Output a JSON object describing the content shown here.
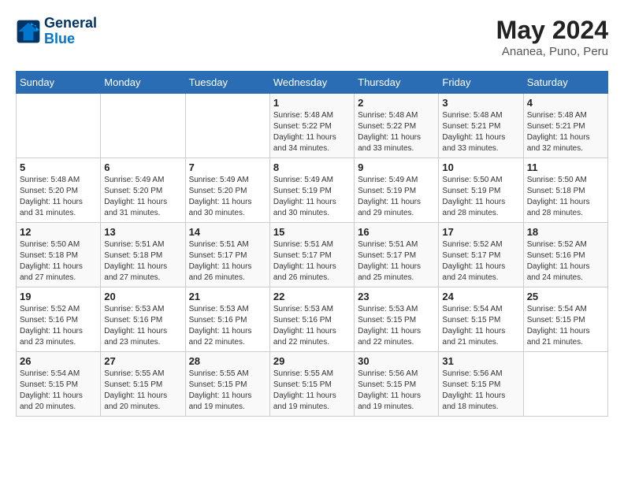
{
  "header": {
    "logo_line1": "General",
    "logo_line2": "Blue",
    "month_year": "May 2024",
    "location": "Ananea, Puno, Peru"
  },
  "weekdays": [
    "Sunday",
    "Monday",
    "Tuesday",
    "Wednesday",
    "Thursday",
    "Friday",
    "Saturday"
  ],
  "weeks": [
    [
      {
        "day": "",
        "info": ""
      },
      {
        "day": "",
        "info": ""
      },
      {
        "day": "",
        "info": ""
      },
      {
        "day": "1",
        "info": "Sunrise: 5:48 AM\nSunset: 5:22 PM\nDaylight: 11 hours\nand 34 minutes."
      },
      {
        "day": "2",
        "info": "Sunrise: 5:48 AM\nSunset: 5:22 PM\nDaylight: 11 hours\nand 33 minutes."
      },
      {
        "day": "3",
        "info": "Sunrise: 5:48 AM\nSunset: 5:21 PM\nDaylight: 11 hours\nand 33 minutes."
      },
      {
        "day": "4",
        "info": "Sunrise: 5:48 AM\nSunset: 5:21 PM\nDaylight: 11 hours\nand 32 minutes."
      }
    ],
    [
      {
        "day": "5",
        "info": "Sunrise: 5:48 AM\nSunset: 5:20 PM\nDaylight: 11 hours\nand 31 minutes."
      },
      {
        "day": "6",
        "info": "Sunrise: 5:49 AM\nSunset: 5:20 PM\nDaylight: 11 hours\nand 31 minutes."
      },
      {
        "day": "7",
        "info": "Sunrise: 5:49 AM\nSunset: 5:20 PM\nDaylight: 11 hours\nand 30 minutes."
      },
      {
        "day": "8",
        "info": "Sunrise: 5:49 AM\nSunset: 5:19 PM\nDaylight: 11 hours\nand 30 minutes."
      },
      {
        "day": "9",
        "info": "Sunrise: 5:49 AM\nSunset: 5:19 PM\nDaylight: 11 hours\nand 29 minutes."
      },
      {
        "day": "10",
        "info": "Sunrise: 5:50 AM\nSunset: 5:19 PM\nDaylight: 11 hours\nand 28 minutes."
      },
      {
        "day": "11",
        "info": "Sunrise: 5:50 AM\nSunset: 5:18 PM\nDaylight: 11 hours\nand 28 minutes."
      }
    ],
    [
      {
        "day": "12",
        "info": "Sunrise: 5:50 AM\nSunset: 5:18 PM\nDaylight: 11 hours\nand 27 minutes."
      },
      {
        "day": "13",
        "info": "Sunrise: 5:51 AM\nSunset: 5:18 PM\nDaylight: 11 hours\nand 27 minutes."
      },
      {
        "day": "14",
        "info": "Sunrise: 5:51 AM\nSunset: 5:17 PM\nDaylight: 11 hours\nand 26 minutes."
      },
      {
        "day": "15",
        "info": "Sunrise: 5:51 AM\nSunset: 5:17 PM\nDaylight: 11 hours\nand 26 minutes."
      },
      {
        "day": "16",
        "info": "Sunrise: 5:51 AM\nSunset: 5:17 PM\nDaylight: 11 hours\nand 25 minutes."
      },
      {
        "day": "17",
        "info": "Sunrise: 5:52 AM\nSunset: 5:17 PM\nDaylight: 11 hours\nand 24 minutes."
      },
      {
        "day": "18",
        "info": "Sunrise: 5:52 AM\nSunset: 5:16 PM\nDaylight: 11 hours\nand 24 minutes."
      }
    ],
    [
      {
        "day": "19",
        "info": "Sunrise: 5:52 AM\nSunset: 5:16 PM\nDaylight: 11 hours\nand 23 minutes."
      },
      {
        "day": "20",
        "info": "Sunrise: 5:53 AM\nSunset: 5:16 PM\nDaylight: 11 hours\nand 23 minutes."
      },
      {
        "day": "21",
        "info": "Sunrise: 5:53 AM\nSunset: 5:16 PM\nDaylight: 11 hours\nand 22 minutes."
      },
      {
        "day": "22",
        "info": "Sunrise: 5:53 AM\nSunset: 5:16 PM\nDaylight: 11 hours\nand 22 minutes."
      },
      {
        "day": "23",
        "info": "Sunrise: 5:53 AM\nSunset: 5:15 PM\nDaylight: 11 hours\nand 22 minutes."
      },
      {
        "day": "24",
        "info": "Sunrise: 5:54 AM\nSunset: 5:15 PM\nDaylight: 11 hours\nand 21 minutes."
      },
      {
        "day": "25",
        "info": "Sunrise: 5:54 AM\nSunset: 5:15 PM\nDaylight: 11 hours\nand 21 minutes."
      }
    ],
    [
      {
        "day": "26",
        "info": "Sunrise: 5:54 AM\nSunset: 5:15 PM\nDaylight: 11 hours\nand 20 minutes."
      },
      {
        "day": "27",
        "info": "Sunrise: 5:55 AM\nSunset: 5:15 PM\nDaylight: 11 hours\nand 20 minutes."
      },
      {
        "day": "28",
        "info": "Sunrise: 5:55 AM\nSunset: 5:15 PM\nDaylight: 11 hours\nand 19 minutes."
      },
      {
        "day": "29",
        "info": "Sunrise: 5:55 AM\nSunset: 5:15 PM\nDaylight: 11 hours\nand 19 minutes."
      },
      {
        "day": "30",
        "info": "Sunrise: 5:56 AM\nSunset: 5:15 PM\nDaylight: 11 hours\nand 19 minutes."
      },
      {
        "day": "31",
        "info": "Sunrise: 5:56 AM\nSunset: 5:15 PM\nDaylight: 11 hours\nand 18 minutes."
      },
      {
        "day": "",
        "info": ""
      }
    ]
  ]
}
